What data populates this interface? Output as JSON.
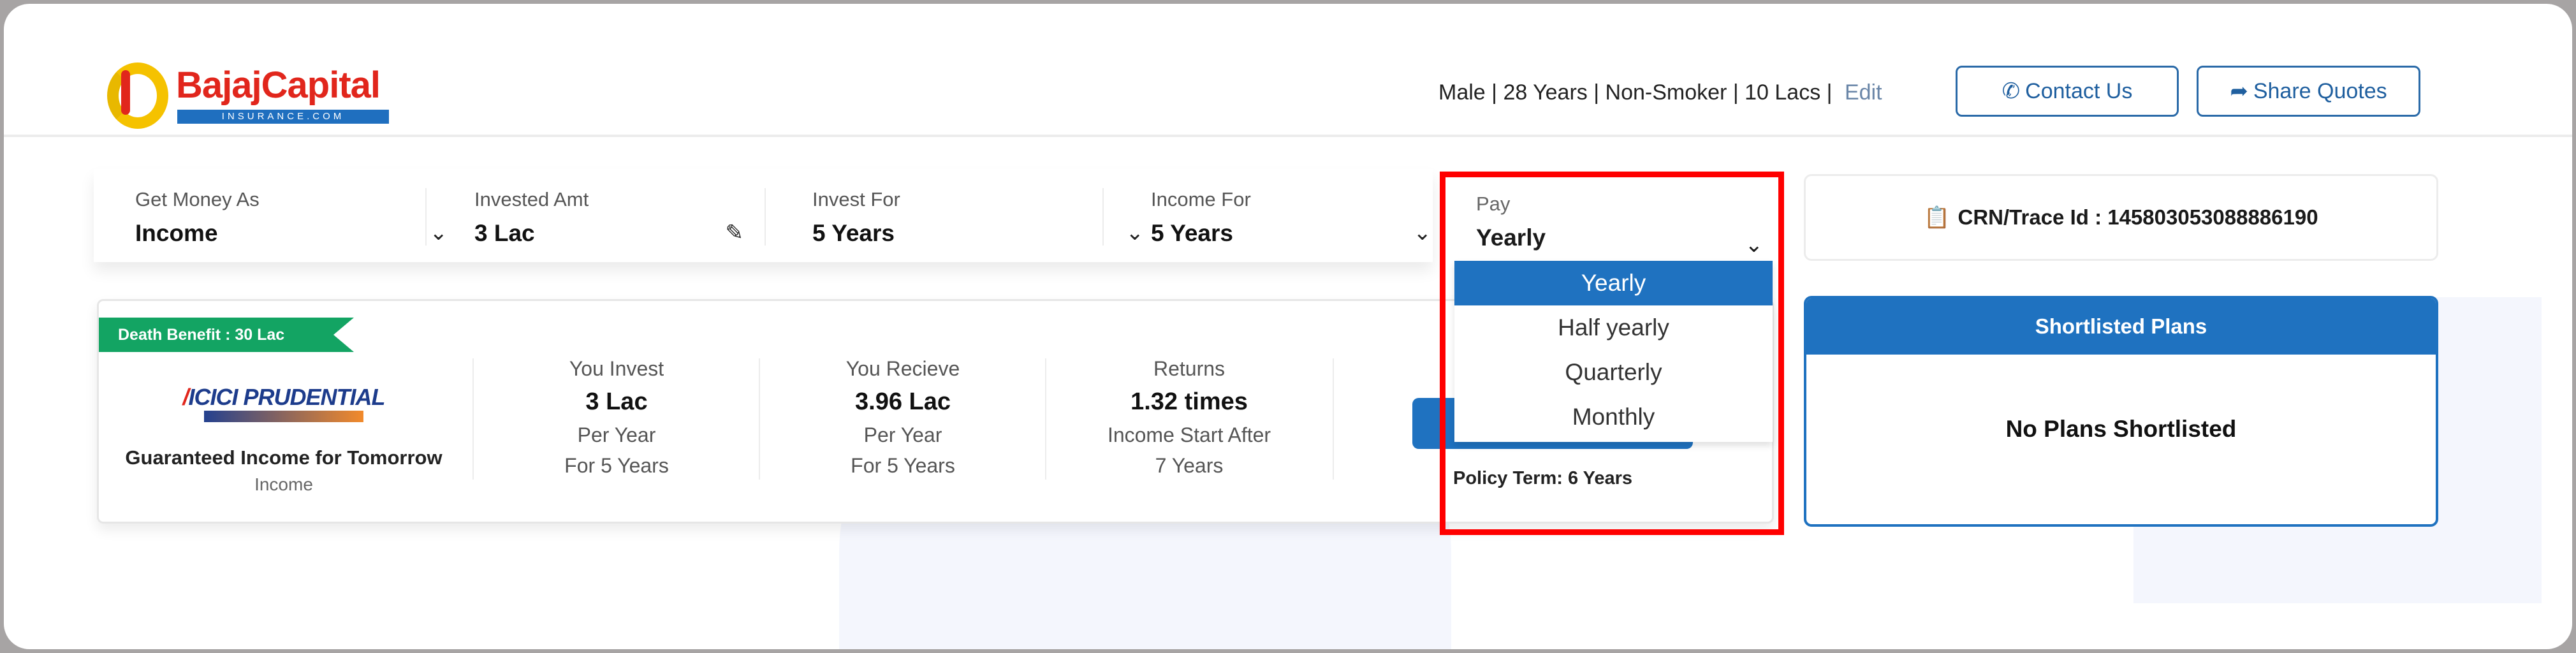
{
  "header": {
    "logo": {
      "brand": "BajajCapital",
      "sub": "INSURANCE.COM"
    },
    "profile": {
      "gender": "Male",
      "age": "28 Years",
      "smoker": "Non-Smoker",
      "cover": "10 Lacs",
      "edit": "Edit"
    },
    "contact_label": "Contact Us",
    "share_label": "Share Quotes"
  },
  "filters": [
    {
      "label": "Get Money As",
      "value": "Income",
      "icon": "chevron-down-icon"
    },
    {
      "label": "Invested Amt",
      "value": "3 Lac",
      "icon": "edit-icon"
    },
    {
      "label": "Invest For",
      "value": "5 Years",
      "icon": "chevron-down-icon"
    },
    {
      "label": "Income For",
      "value": "5 Years",
      "icon": "chevron-down-icon"
    },
    {
      "label": "Pay",
      "value": "Yearly",
      "icon": "chevron-down-icon"
    }
  ],
  "pay_dropdown": {
    "options": [
      "Yearly",
      "Half yearly",
      "Quarterly",
      "Monthly"
    ],
    "selected": "Yearly"
  },
  "crn": {
    "label": "CRN/Trace Id : 145803053088886190",
    "icon": "clipboard-icon"
  },
  "plan": {
    "ribbon": "Death Benefit : 30 Lac",
    "insurer_logo": "ICICI PRUDENTIAL",
    "name": "Guaranteed Income for Tomorrow",
    "type": "Income",
    "invest": {
      "label": "You Invest",
      "value": "3 Lac",
      "l1": "Per Year",
      "l2": "For 5 Years"
    },
    "receive": {
      "label": "You Recieve",
      "value": "3.96 Lac",
      "l1": "Per Year",
      "l2": "For 5 Years"
    },
    "returns": {
      "label": "Returns",
      "value": "1.32 times",
      "l1": "Income Start After",
      "l2": "7 Years"
    },
    "policy_term": "Policy Term: 6 Years"
  },
  "shortlist": {
    "title": "Shortlisted Plans",
    "empty": "No Plans Shortlisted"
  },
  "colors": {
    "primary": "#1f72c0",
    "ribbon": "#13a463",
    "highlight": "#ff0000"
  }
}
